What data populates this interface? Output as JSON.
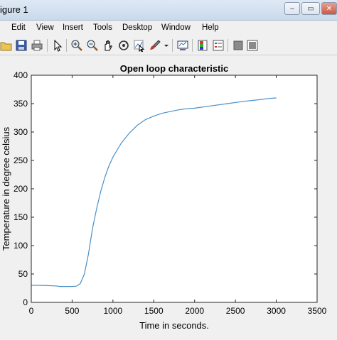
{
  "window": {
    "title": "igure 1",
    "minimize_glyph": "–",
    "restore_glyph": "▭",
    "close_glyph": "✕"
  },
  "menu": {
    "items": [
      "Edit",
      "View",
      "Insert",
      "Tools",
      "Desktop",
      "Window",
      "Help"
    ]
  },
  "toolbar": {
    "icons": [
      "open-icon",
      "save-icon",
      "print-icon",
      "pointer-icon",
      "zoom-in-icon",
      "zoom-out-icon",
      "pan-icon",
      "rotate-icon",
      "data-cursor-icon",
      "brush-icon",
      "link-icon",
      "colorbar-icon",
      "legend-icon",
      "hide-tools-icon",
      "show-tools-icon"
    ]
  },
  "chart_data": {
    "type": "line",
    "title": "Open loop characteristic",
    "xlabel": "Time in seconds.",
    "ylabel": "Temperature in degree celsius",
    "xlim": [
      0,
      3500
    ],
    "ylim": [
      0,
      400
    ],
    "xticks": [
      0,
      500,
      1000,
      1500,
      2000,
      2500,
      3000,
      3500
    ],
    "yticks": [
      0,
      50,
      100,
      150,
      200,
      250,
      300,
      350,
      400
    ],
    "grid": false,
    "line_color": "#4a90c8",
    "series": [
      {
        "x": [
          0,
          100,
          200,
          300,
          350,
          400,
          500,
          550,
          600,
          650,
          700,
          750,
          800,
          850,
          900,
          950,
          1000,
          1100,
          1200,
          1300,
          1400,
          1500,
          1600,
          1700,
          1800,
          1900,
          2000,
          2200,
          2400,
          2600,
          2800,
          2900,
          3000
        ],
        "y": [
          30,
          30,
          29.5,
          29,
          28,
          28,
          28,
          28.5,
          33,
          50,
          85,
          130,
          165,
          195,
          220,
          240,
          256,
          280,
          298,
          312,
          322,
          328,
          333,
          336,
          339,
          341,
          342,
          346,
          350,
          354,
          357,
          359,
          360
        ]
      }
    ]
  }
}
